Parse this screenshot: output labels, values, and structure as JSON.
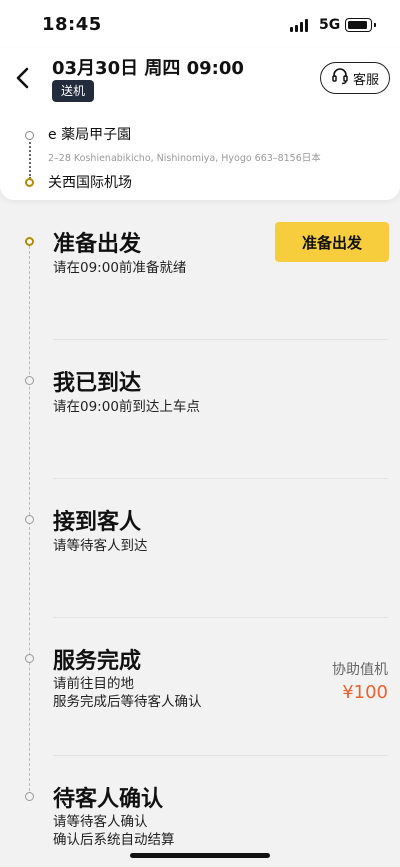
{
  "status_bar": {
    "time": "18:45",
    "network": "5G"
  },
  "header": {
    "title": "03月30日 周四 09:00",
    "tag": "送机",
    "service_label": "客服",
    "route": {
      "from_name": "e 薬局甲子園",
      "from_address": "2–28 Koshienabikicho, Nishinomiya, Hyogo 663–8156日本",
      "to_name": "关西国际机场"
    }
  },
  "steps": [
    {
      "title": "准备出发",
      "desc_lines": [
        "请在09:00前准备就绪"
      ],
      "action_label": "准备出发"
    },
    {
      "title": "我已到达",
      "desc_lines": [
        "请在09:00前到达上车点"
      ]
    },
    {
      "title": "接到客人",
      "desc_lines": [
        "请等待客人到达"
      ]
    },
    {
      "title": "服务完成",
      "desc_lines": [
        "请前往目的地",
        "服务完成后等待客人确认"
      ],
      "side_label": "协助值机",
      "side_price": "¥100"
    },
    {
      "title": "待客人确认",
      "desc_lines": [
        "请等待客人确认",
        "确认后系统自动结算"
      ]
    }
  ],
  "colors": {
    "accent_yellow": "#f7cc3d",
    "price_orange": "#e8632f",
    "tag_dark": "#222c3d"
  }
}
